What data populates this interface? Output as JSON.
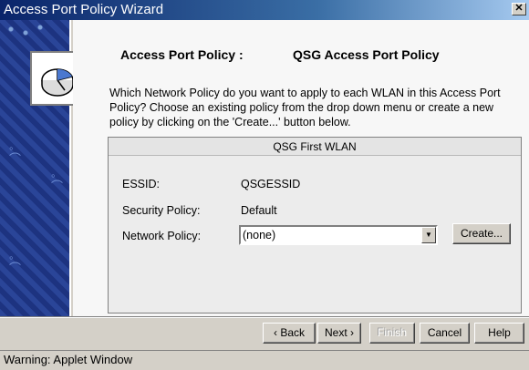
{
  "window": {
    "title": "Access Port Policy Wizard",
    "close_glyph": "✕"
  },
  "policy": {
    "label": "Access Port Policy :",
    "name": "QSG Access Port Policy"
  },
  "description": "Which Network Policy do you want to apply to each WLAN in this Access Port Policy? Choose an existing policy from the drop down menu or create a new policy by clicking on the 'Create...' button below.",
  "wlan": {
    "title": "QSG First WLAN",
    "essid_label": "ESSID:",
    "essid_value": "QSGESSID",
    "security_label": "Security Policy:",
    "security_value": "Default",
    "network_label": "Network Policy:",
    "network_value": "(none)",
    "create_label": "Create..."
  },
  "buttons": {
    "back": "‹ Back",
    "next": "Next ›",
    "finish": "Finish",
    "cancel": "Cancel",
    "help": "Help"
  },
  "status": "Warning: Applet Window",
  "icons": [
    "close-icon",
    "policy-icon",
    "wifi-icon",
    "dropdown-arrow-icon"
  ]
}
